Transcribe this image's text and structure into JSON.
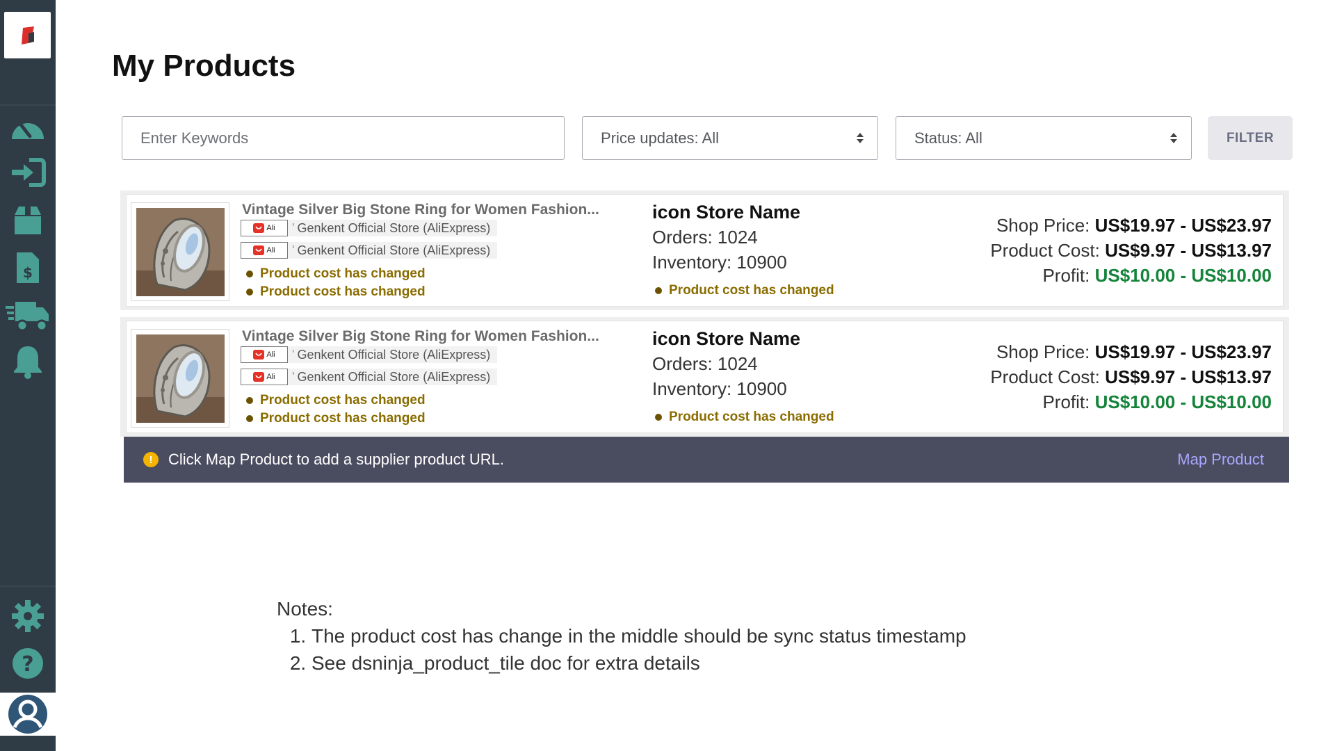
{
  "page": {
    "title": "My Products"
  },
  "filters": {
    "keyword_placeholder": "Enter Keywords",
    "price_updates_label": "Price updates: All",
    "status_label": "Status: All",
    "filter_button": "FILTER"
  },
  "sidebar": {
    "items": [
      {
        "icon": "dashboard-gauge-icon"
      },
      {
        "icon": "import-icon"
      },
      {
        "icon": "products-box-icon"
      },
      {
        "icon": "invoice-dollar-icon"
      },
      {
        "icon": "shipping-truck-icon"
      },
      {
        "icon": "notification-bell-icon"
      },
      {
        "icon": "settings-gear-icon"
      },
      {
        "icon": "help-question-icon"
      },
      {
        "icon": "user-avatar-icon"
      }
    ]
  },
  "products": [
    {
      "title": "Vintage Silver Big Stone Ring for Women Fashion...",
      "suppliers": [
        {
          "badge": "Ali",
          "name": "Genkent Official Store (AliExpress)"
        },
        {
          "badge": "Ali",
          "name": "Genkent Official Store (AliExpress)"
        }
      ],
      "statuses": [
        "Product cost has changed",
        "Product cost has changed"
      ],
      "store_name": "icon Store Name",
      "orders": "Orders: 1024",
      "inventory": "Inventory: 10900",
      "store_status": "Product cost has changed",
      "shop_price_label": "Shop Price:",
      "shop_price": "US$19.97 - US$23.97",
      "product_cost_label": "Product Cost:",
      "product_cost": "US$9.97 - US$13.97",
      "profit_label": "Profit:",
      "profit": "US$10.00 - US$10.00"
    },
    {
      "title": "Vintage Silver Big Stone Ring for Women Fashion...",
      "suppliers": [
        {
          "badge": "Ali",
          "name": "Genkent Official Store (AliExpress)"
        },
        {
          "badge": "Ali",
          "name": "Genkent Official Store (AliExpress)"
        }
      ],
      "statuses": [
        "Product cost has changed",
        "Product cost has changed"
      ],
      "store_name": "icon Store Name",
      "orders": "Orders: 1024",
      "inventory": "Inventory: 10900",
      "store_status": "Product cost has changed",
      "shop_price_label": "Shop Price:",
      "shop_price": "US$19.97 - US$23.97",
      "product_cost_label": "Product Cost:",
      "product_cost": "US$9.97 - US$13.97",
      "profit_label": "Profit:",
      "profit": "US$10.00 - US$10.00"
    }
  ],
  "notice": {
    "icon": "warning-icon",
    "message": "Click Map Product to add a supplier product URL.",
    "action": "Map Product"
  },
  "notes": {
    "heading": "Notes:",
    "items": [
      "The product cost has change in the middle should be sync status timestamp",
      "See dsninja_product_tile doc for extra details"
    ]
  },
  "colors": {
    "sidebar_bg": "#2f3b45",
    "icon_teal": "#4a9f95",
    "status_gold": "#8a6c00",
    "profit_green": "#14843a",
    "notice_bg": "#4a4c60",
    "link_purple": "#a9a8ff"
  }
}
